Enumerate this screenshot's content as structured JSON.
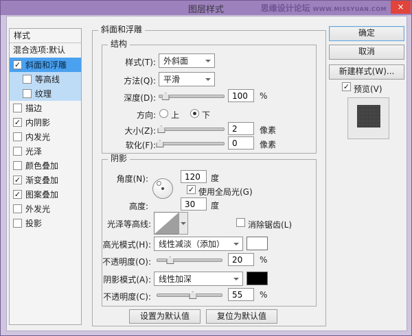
{
  "window": {
    "title": "图层样式",
    "watermark_cn": "思缘设计论坛",
    "watermark_url": "WWW.MISSYUAN.COM",
    "close_glyph": "×"
  },
  "colors": {
    "titlebar": "#9d81bc",
    "close_red": "#e0443a",
    "selection_blue": "#4aa1f0",
    "sub_selection_blue": "#bedcf6",
    "highlight_swatch": "#ffffff",
    "shadow_swatch": "#000000"
  },
  "sidebar": {
    "header": "样式",
    "blend_item": "混合选项:默认",
    "items": [
      {
        "label": "斜面和浮雕",
        "checked": true,
        "check": "✓"
      },
      {
        "label": "等高线",
        "checked": false,
        "check": ""
      },
      {
        "label": "纹理",
        "checked": false,
        "check": ""
      },
      {
        "label": "描边",
        "checked": false,
        "check": ""
      },
      {
        "label": "内阴影",
        "checked": true,
        "check": "✓"
      },
      {
        "label": "内发光",
        "checked": false,
        "check": ""
      },
      {
        "label": "光泽",
        "checked": false,
        "check": ""
      },
      {
        "label": "颜色叠加",
        "checked": false,
        "check": ""
      },
      {
        "label": "渐变叠加",
        "checked": true,
        "check": "✓"
      },
      {
        "label": "图案叠加",
        "checked": true,
        "check": "✓"
      },
      {
        "label": "外发光",
        "checked": false,
        "check": ""
      },
      {
        "label": "投影",
        "checked": false,
        "check": ""
      }
    ]
  },
  "panel": {
    "title": "斜面和浮雕",
    "structure": {
      "title": "结构",
      "style": {
        "label": "样式(T):",
        "value": "外斜面"
      },
      "method": {
        "label": "方法(Q):",
        "value": "平滑"
      },
      "depth": {
        "label": "深度(D):",
        "value": "100",
        "unit": "%",
        "percent": 10
      },
      "direction": {
        "label": "方向:",
        "up": "上",
        "down": "下",
        "selected": "下"
      },
      "size": {
        "label": "大小(Z):",
        "value": "2",
        "unit": "像素",
        "percent": 3
      },
      "soften": {
        "label": "软化(F):",
        "value": "0",
        "unit": "像素",
        "percent": 1
      }
    },
    "shading": {
      "title": "阴影",
      "angle": {
        "label": "角度(N):",
        "value": "120",
        "unit": "度"
      },
      "global_light": {
        "label": "使用全局光(G)",
        "checked": true,
        "check": "✓"
      },
      "altitude": {
        "label": "高度:",
        "value": "30",
        "unit": "度"
      },
      "gloss_contour": {
        "label": "光泽等高线:"
      },
      "anti_alias": {
        "label": "消除锯齿(L)",
        "checked": false,
        "check": ""
      },
      "highlight_mode": {
        "label": "高光模式(H):",
        "value": "线性减淡（添加）",
        "swatch": "#ffffff"
      },
      "highlight_opacity": {
        "label": "不透明度(O):",
        "value": "20",
        "unit": "%",
        "percent": 20
      },
      "shadow_mode": {
        "label": "阴影模式(A):",
        "value": "线性加深",
        "swatch": "#000000"
      },
      "shadow_opacity": {
        "label": "不透明度(C):",
        "value": "55",
        "unit": "%",
        "percent": 55
      }
    },
    "footer": {
      "set_default": "设置为默认值",
      "reset_default": "复位为默认值"
    }
  },
  "actions": {
    "ok": "确定",
    "cancel": "取消",
    "new_style": "新建样式(W)...",
    "preview": {
      "label": "预览(V)",
      "checked": true,
      "check": "✓"
    }
  }
}
